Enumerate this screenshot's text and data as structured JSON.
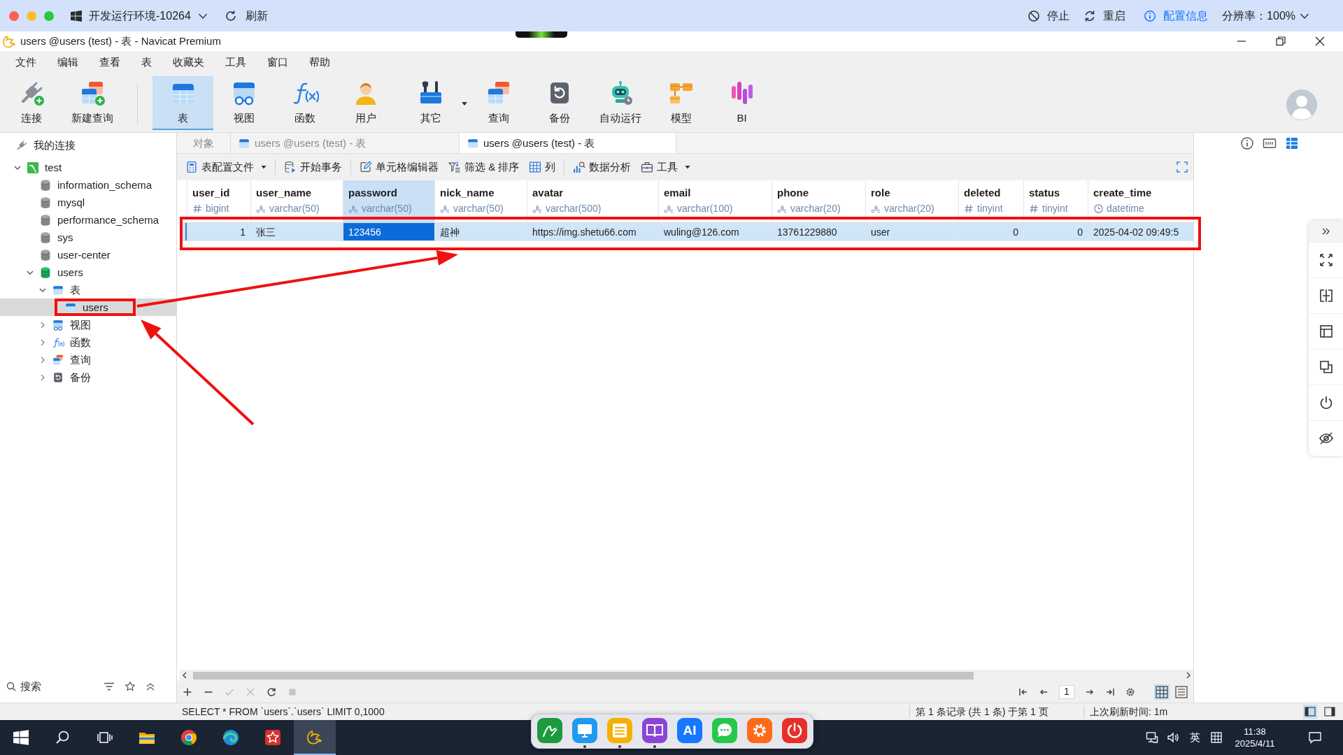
{
  "topbar": {
    "env": "开发运行环境-10264",
    "refresh": "刷新",
    "actions": [
      {
        "kind": "stop",
        "label": "停止"
      },
      {
        "kind": "restart",
        "label": "重启"
      },
      {
        "kind": "info",
        "label": "配置信息"
      }
    ],
    "resolution": "分辨率：100%"
  },
  "window": {
    "title": "users @users (test) - 表 - Navicat Premium"
  },
  "menu": [
    "文件",
    "编辑",
    "查看",
    "表",
    "收藏夹",
    "工具",
    "窗口",
    "帮助"
  ],
  "toolbar": {
    "groups": [
      [
        {
          "kind": "connect",
          "label": "连接",
          "selected": false,
          "dropdown": false
        },
        {
          "kind": "new_query",
          "label": "新建查询",
          "selected": false,
          "dropdown": false
        }
      ],
      [
        {
          "kind": "table",
          "label": "表",
          "selected": true,
          "dropdown": false
        },
        {
          "kind": "view",
          "label": "视图",
          "selected": false,
          "dropdown": false
        },
        {
          "kind": "function",
          "label": "函数",
          "selected": false,
          "dropdown": false
        },
        {
          "kind": "user",
          "label": "用户",
          "selected": false,
          "dropdown": false
        },
        {
          "kind": "other",
          "label": "其它",
          "selected": false,
          "dropdown": true
        },
        {
          "kind": "query",
          "label": "查询",
          "selected": false,
          "dropdown": false
        },
        {
          "kind": "backup",
          "label": "备份",
          "selected": false,
          "dropdown": false
        },
        {
          "kind": "automation",
          "label": "自动运行",
          "selected": false,
          "dropdown": false
        },
        {
          "kind": "model",
          "label": "模型",
          "selected": false,
          "dropdown": false
        },
        {
          "kind": "bi",
          "label": "BI",
          "selected": false,
          "dropdown": false
        }
      ]
    ]
  },
  "sidebar": {
    "root": "我的连接",
    "tree": [
      {
        "kind": "connection",
        "label": "test",
        "expanded": true,
        "selected": false,
        "children": [
          {
            "kind": "database",
            "label": "information_schema",
            "active": false,
            "selected": false
          },
          {
            "kind": "database",
            "label": "mysql",
            "active": false,
            "selected": false
          },
          {
            "kind": "database",
            "label": "performance_schema",
            "active": false,
            "selected": false
          },
          {
            "kind": "database",
            "label": "sys",
            "active": false,
            "selected": false
          },
          {
            "kind": "database",
            "label": "user-center",
            "active": false,
            "selected": false
          },
          {
            "kind": "database",
            "label": "users",
            "active": true,
            "expanded": true,
            "selected": false,
            "children": [
              {
                "kind": "tables",
                "label": "表",
                "expanded": true,
                "selected": false,
                "children": [
                  {
                    "kind": "table",
                    "label": "users",
                    "selected": true
                  }
                ]
              },
              {
                "kind": "views",
                "label": "视图",
                "expanded": false,
                "selected": false
              },
              {
                "kind": "functions",
                "label": "函数",
                "expanded": false,
                "selected": false
              },
              {
                "kind": "queries",
                "label": "查询",
                "expanded": false,
                "selected": false
              },
              {
                "kind": "backups",
                "label": "备份",
                "expanded": false,
                "selected": false
              }
            ]
          }
        ]
      }
    ],
    "search": {
      "placeholder": "搜索"
    }
  },
  "tabs": [
    {
      "kind": "objects",
      "label": "对象",
      "selected": false
    },
    {
      "kind": "table",
      "label": "users @users (test) - 表",
      "selected": false
    },
    {
      "kind": "table",
      "label": "users @users (test) - 表",
      "selected": true
    }
  ],
  "grid_toolbar": {
    "groups": [
      [
        {
          "kind": "profile",
          "label": "表配置文件",
          "dropdown": true
        }
      ],
      [
        {
          "kind": "transaction",
          "label": "开始事务",
          "dropdown": false
        }
      ],
      [
        {
          "kind": "cell_editor",
          "label": "单元格编辑器",
          "dropdown": false
        },
        {
          "kind": "filter",
          "label": "筛选 & 排序",
          "dropdown": false
        },
        {
          "kind": "columns",
          "label": "列",
          "dropdown": false
        }
      ],
      [
        {
          "kind": "analysis",
          "label": "数据分析",
          "dropdown": false
        },
        {
          "kind": "tools",
          "label": "工具",
          "dropdown": true
        }
      ]
    ]
  },
  "table": {
    "columns": [
      {
        "name": "user_id",
        "type": "bigint",
        "kind": "number",
        "selected": false
      },
      {
        "name": "user_name",
        "type": "varchar(50)",
        "kind": "text",
        "selected": false
      },
      {
        "name": "password",
        "type": "varchar(50)",
        "kind": "text",
        "selected": true
      },
      {
        "name": "nick_name",
        "type": "varchar(50)",
        "kind": "text",
        "selected": false
      },
      {
        "name": "avatar",
        "type": "varchar(500)",
        "kind": "text",
        "selected": false
      },
      {
        "name": "email",
        "type": "varchar(100)",
        "kind": "text",
        "selected": false
      },
      {
        "name": "phone",
        "type": "varchar(20)",
        "kind": "text",
        "selected": false
      },
      {
        "name": "role",
        "type": "varchar(20)",
        "kind": "text",
        "selected": false
      },
      {
        "name": "deleted",
        "type": "tinyint",
        "kind": "number",
        "selected": false
      },
      {
        "name": "status",
        "type": "tinyint",
        "kind": "number",
        "selected": false
      },
      {
        "name": "create_time",
        "type": "datetime",
        "kind": "datetime",
        "selected": false
      }
    ],
    "rows": [
      {
        "selected": true,
        "cells": [
          {
            "value": "1",
            "selected": false
          },
          {
            "value": "张三",
            "selected": false
          },
          {
            "value": "123456",
            "selected": true
          },
          {
            "value": "超神",
            "selected": false
          },
          {
            "value": "https://img.shetu66.com",
            "selected": false
          },
          {
            "value": "wuling@126.com",
            "selected": false
          },
          {
            "value": "13761229880",
            "selected": false
          },
          {
            "value": "user",
            "selected": false
          },
          {
            "value": "0",
            "selected": false
          },
          {
            "value": "0",
            "selected": false
          },
          {
            "value": "2025-04-02 09:49:5",
            "selected": false
          }
        ]
      }
    ]
  },
  "grid_footer": {
    "actions": [
      {
        "kind": "add",
        "disabled": false
      },
      {
        "kind": "remove",
        "disabled": false
      },
      {
        "kind": "apply",
        "disabled": true
      },
      {
        "kind": "discard",
        "disabled": true
      },
      {
        "kind": "refresh",
        "disabled": false
      },
      {
        "kind": "stop",
        "disabled": true
      }
    ],
    "page": "1",
    "views": [
      {
        "kind": "grid",
        "selected": true
      },
      {
        "kind": "form",
        "selected": false
      }
    ]
  },
  "right_panel": {
    "views": [
      {
        "kind": "info",
        "selected": false
      },
      {
        "kind": "ddl",
        "selected": false
      },
      {
        "kind": "grid",
        "selected": true
      }
    ]
  },
  "status_bar": {
    "sql": "SELECT * FROM `users`.`users` LIMIT 0,1000",
    "record": "第 1 条记录 (共 1 条) 于第 1 页",
    "refresh": "上次刷新时间: 1m",
    "layouts": [
      {
        "kind": "left",
        "selected": true
      },
      {
        "kind": "right",
        "selected": false
      }
    ]
  },
  "taskbar": {
    "apps": [
      {
        "kind": "start",
        "selected": false
      },
      {
        "kind": "search",
        "selected": false
      },
      {
        "kind": "task_view",
        "selected": false
      },
      {
        "kind": "folder",
        "selected": false
      },
      {
        "kind": "ring",
        "selected": false
      },
      {
        "kind": "wave",
        "selected": false
      },
      {
        "kind": "star_tile",
        "selected": false
      },
      {
        "kind": "leaf",
        "selected": true
      }
    ],
    "ime": "英",
    "time": "11:38",
    "date": "2025/4/11"
  },
  "dock": [
    {
      "kind": "pen",
      "running": false
    },
    {
      "kind": "monitor",
      "running": true
    },
    {
      "kind": "notes",
      "running": true
    },
    {
      "kind": "book",
      "running": true
    },
    {
      "kind": "ai",
      "text": "AI",
      "running": false
    },
    {
      "kind": "chat",
      "running": false
    },
    {
      "kind": "gear",
      "running": false
    },
    {
      "kind": "power",
      "running": false
    }
  ],
  "annotations": [
    {
      "kind": "frame"
    },
    {
      "kind": "frame"
    },
    {
      "kind": "arrow"
    },
    {
      "kind": "arrow"
    }
  ]
}
